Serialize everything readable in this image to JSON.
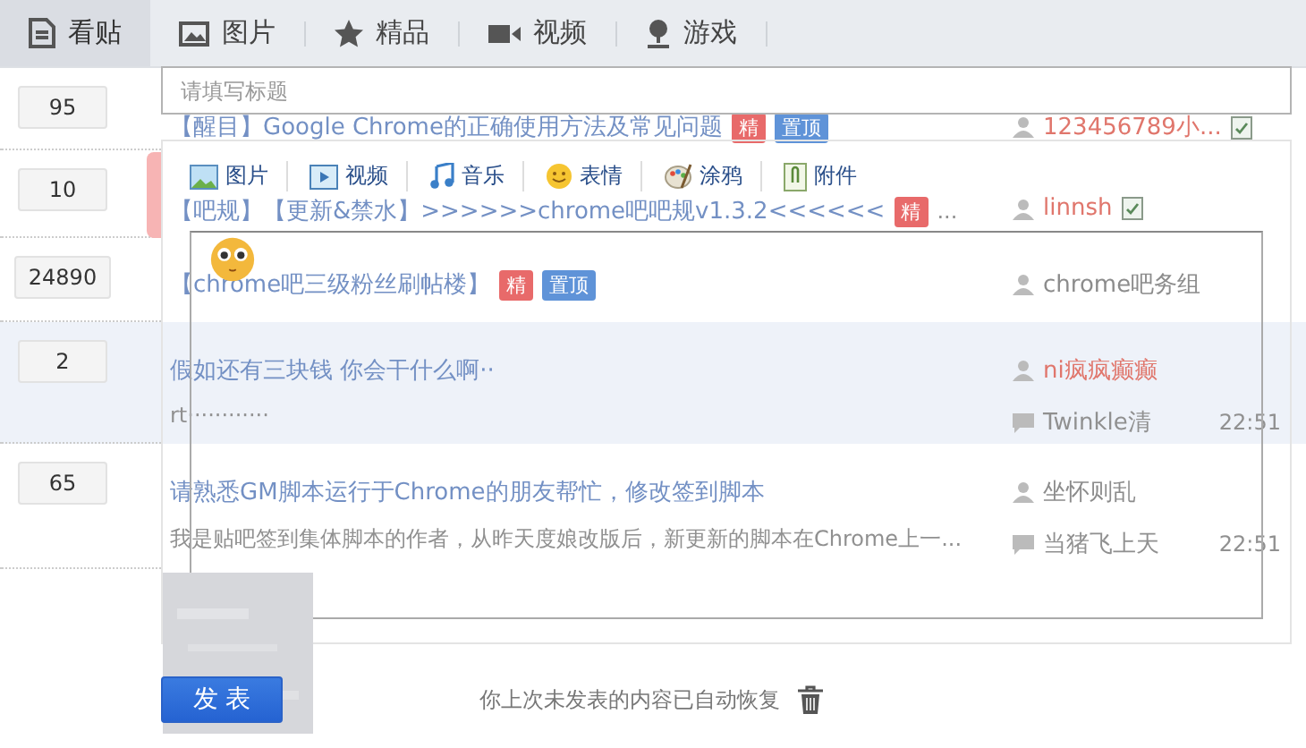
{
  "tabs": [
    {
      "label": "看贴",
      "selected": true
    },
    {
      "label": "图片",
      "selected": false
    },
    {
      "label": "精品",
      "selected": false
    },
    {
      "label": "视频",
      "selected": false
    },
    {
      "label": "游戏",
      "selected": false
    }
  ],
  "threads": [
    {
      "replies": "95",
      "title": "【醒目】Google Chrome的正确使用方法及常见问题",
      "tags": [
        {
          "label": "精",
          "kind": "featured"
        },
        {
          "label": "置顶",
          "kind": "pinned"
        }
      ],
      "author": "123456789小...",
      "color": "#e0766c",
      "verified": true,
      "highlighted": false
    },
    {
      "replies": "10",
      "title": "【吧规】【更新&禁水】>>>>>>chrome吧吧规v1.3.2<<<<<<",
      "tags": [
        {
          "label": "精",
          "kind": "featured"
        }
      ],
      "suffix": "...",
      "author": "linnsh",
      "color": "#e0766c",
      "verified": true,
      "highlighted": false
    },
    {
      "replies": "24890",
      "title": "【chrome吧三级粉丝刷帖楼】",
      "tags": [
        {
          "label": "精",
          "kind": "featured"
        },
        {
          "label": "置顶",
          "kind": "pinned"
        }
      ],
      "author": "chrome吧务组",
      "color": "#8c8c8c",
      "verified": false,
      "highlighted": false
    },
    {
      "replies": "2",
      "title": "假如还有三块钱 你会干什么啊··",
      "excerpt": "rt············",
      "author": "ni疯疯癫癫",
      "color": "#e0766c",
      "verified": false,
      "last_replier": "Twinkle清",
      "time": "22:51",
      "highlighted": true
    },
    {
      "replies": "65",
      "title": "请熟悉GM脚本运行于Chrome的朋友帮忙，修改签到脚本",
      "excerpt": "我是贴吧签到集体脚本的作者，从昨天度娘改版后，新更新的脚本在Chrome上一...",
      "author": "坐怀则乱",
      "color": "#8c8c8c",
      "verified": false,
      "last_replier": "当猪飞上天",
      "time": "22:51",
      "highlighted": false
    }
  ],
  "editor": {
    "title_placeholder": "请填写标题",
    "tools": [
      "图片",
      "视频",
      "音乐",
      "表情",
      "涂鸦",
      "附件"
    ],
    "post_button": "发 表",
    "restore_notice": "你上次未发表的内容已自动恢复"
  }
}
